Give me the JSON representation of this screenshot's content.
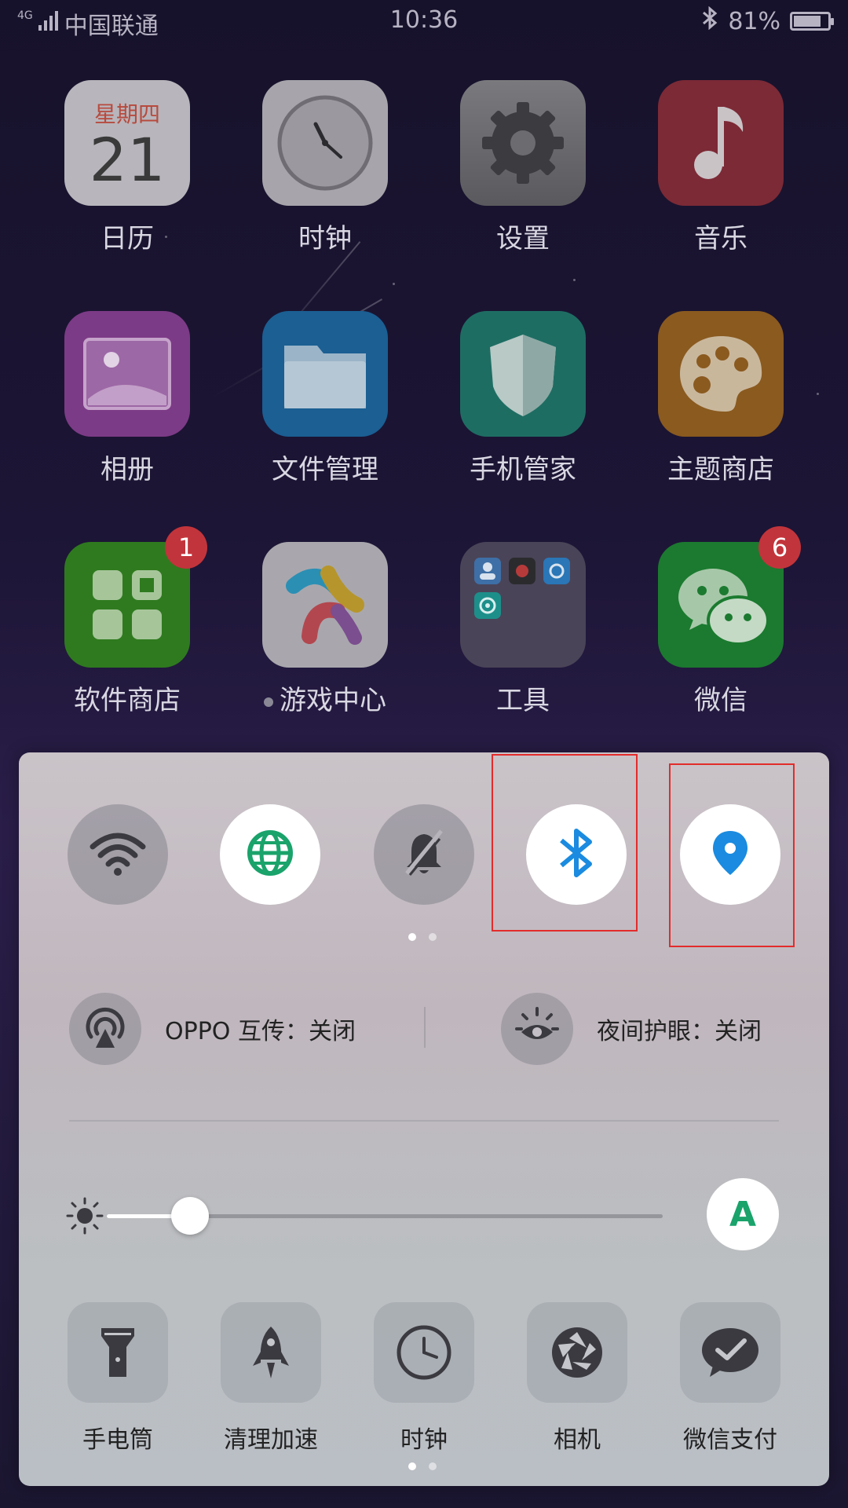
{
  "status_bar": {
    "carrier": "中国联通",
    "network": "4G",
    "time": "10:36",
    "battery": "81%",
    "battery_level": 0.81
  },
  "home_apps": [
    {
      "label": "日历",
      "weekday": "星期四",
      "day": "21",
      "icon": "calendar-icon"
    },
    {
      "label": "时钟",
      "icon": "clock-icon"
    },
    {
      "label": "设置",
      "icon": "gear-icon"
    },
    {
      "label": "音乐",
      "icon": "music-note-icon"
    },
    {
      "label": "相册",
      "icon": "photo-album-icon"
    },
    {
      "label": "文件管理",
      "icon": "folder-icon"
    },
    {
      "label": "手机管家",
      "icon": "shield-icon"
    },
    {
      "label": "主题商店",
      "icon": "palette-icon"
    },
    {
      "label": "软件商店",
      "badge": "1",
      "icon": "app-store-icon"
    },
    {
      "label": "游戏中心",
      "icon": "game-center-icon"
    },
    {
      "label": "工具",
      "icon": "tools-folder-icon"
    },
    {
      "label": "微信",
      "badge": "6",
      "icon": "wechat-icon"
    }
  ],
  "control_center": {
    "toggles": [
      {
        "name": "wifi",
        "icon": "wifi-icon",
        "state": "off"
      },
      {
        "name": "mobile-data",
        "icon": "globe-icon",
        "state": "on"
      },
      {
        "name": "silent",
        "icon": "bell-slash-icon",
        "state": "off"
      },
      {
        "name": "bluetooth",
        "icon": "bluetooth-icon",
        "state": "on"
      },
      {
        "name": "location",
        "icon": "location-pin-icon",
        "state": "on"
      }
    ],
    "features": {
      "oppo_share": "OPPO 互传：关闭",
      "night_shield": "夜间护眼：关闭"
    },
    "brightness": {
      "level": 0.15,
      "auto_label": "A"
    },
    "shortcuts": [
      "手电筒",
      "清理加速",
      "时钟",
      "相机",
      "微信支付"
    ],
    "colors": {
      "accent_blue": "#1a8be0",
      "accent_green": "#1aa36b",
      "highlight_red": "#e32b2b"
    }
  }
}
